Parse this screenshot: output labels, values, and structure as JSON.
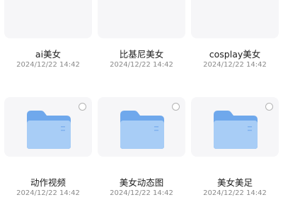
{
  "folders": [
    {
      "name": "ai美女",
      "date": "2024/12/22 14:42",
      "selectable": false
    },
    {
      "name": "比基尼美女",
      "date": "2024/12/22 14:42",
      "selectable": false
    },
    {
      "name": "cosplay美女",
      "date": "2024/12/22 14:42",
      "selectable": false
    },
    {
      "name": "动作视频",
      "date": "2024/12/22 14:42",
      "selectable": true
    },
    {
      "name": "美女动态图",
      "date": "2024/12/22 14:42",
      "selectable": true
    },
    {
      "name": "美女美足",
      "date": "2024/12/22 14:42",
      "selectable": true
    }
  ],
  "icons": {
    "folder": "folder-icon",
    "select": "select-radio-icon"
  },
  "colors": {
    "folder_back": "#6fa8ec",
    "folder_front": "#a8cdf6",
    "card_bg": "#f6f6f8"
  }
}
